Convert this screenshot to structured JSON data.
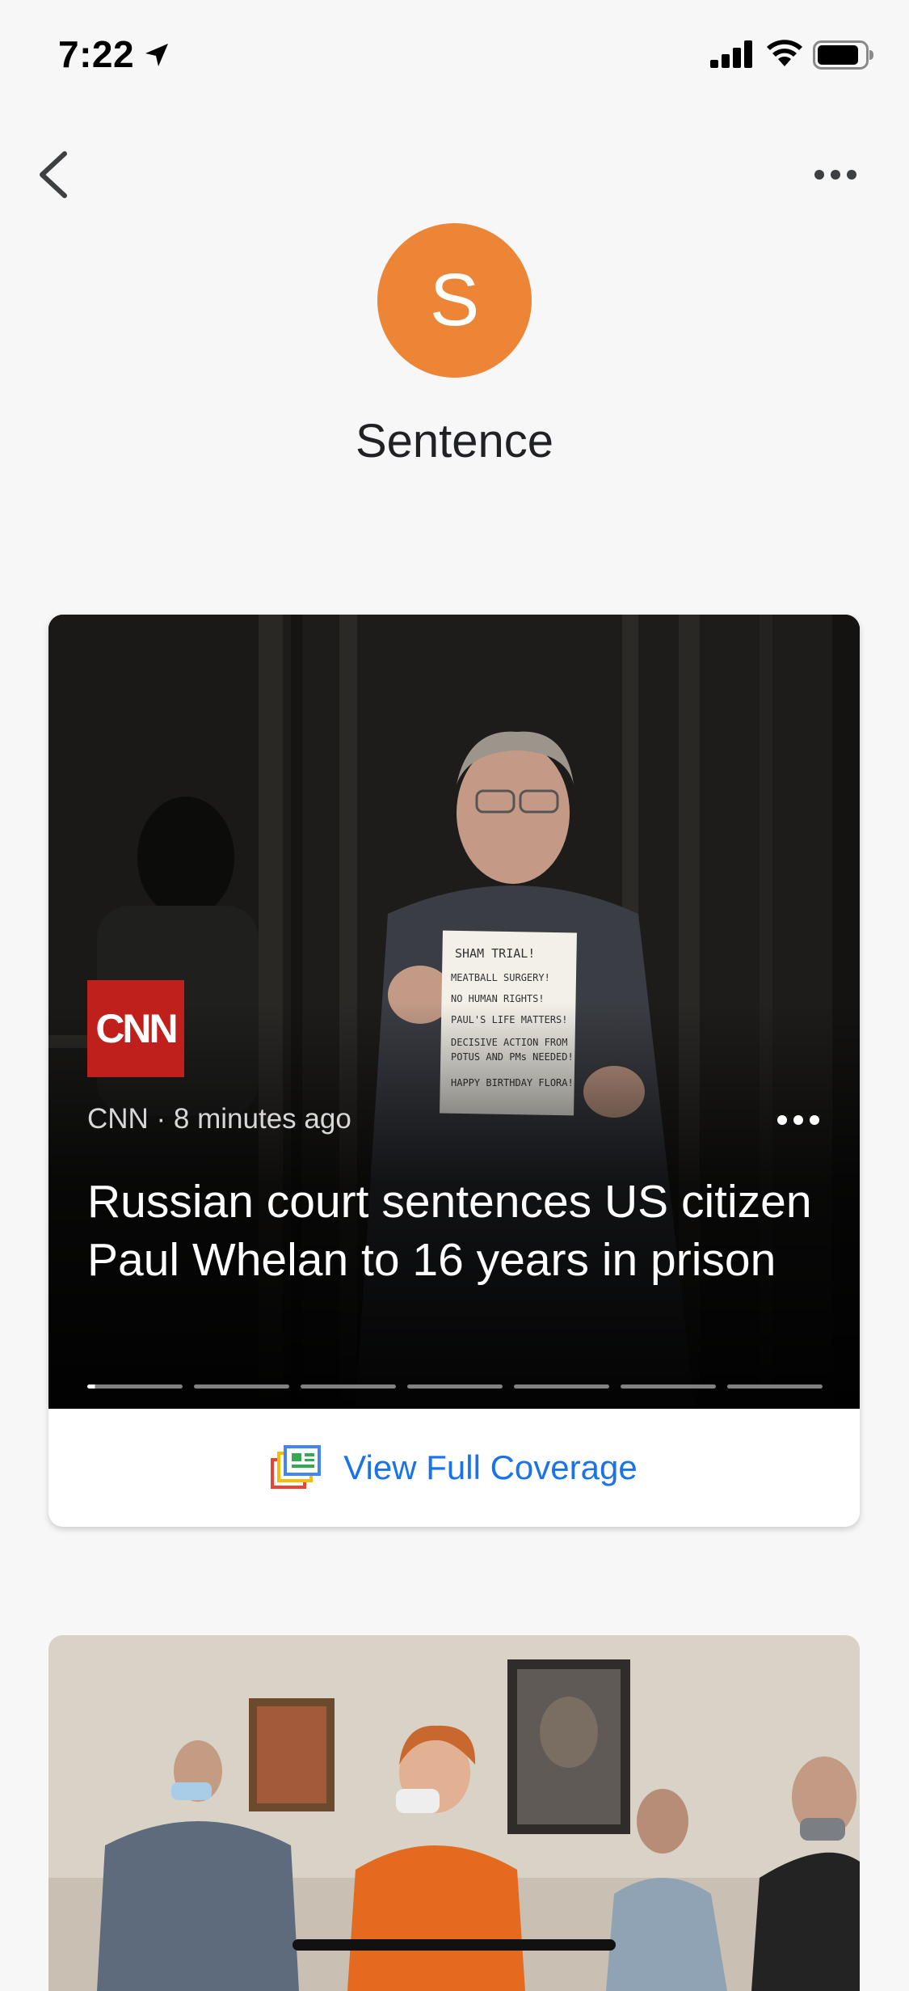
{
  "status_bar": {
    "time": "7:22"
  },
  "header": {
    "back_icon": "chevron-left-icon",
    "more_icon": "more-horizontal-icon"
  },
  "topic": {
    "avatar_letter": "S",
    "avatar_color": "#ec8536",
    "title": "Sentence"
  },
  "story": {
    "source_logo": "CNN",
    "source_logo_color": "#c0201c",
    "meta": "CNN · 8 minutes ago",
    "headline": "Russian court sentences US citizen Paul Whelan to 16 years in prison",
    "sign_lines": [
      "SHAM TRIAL!",
      "MEATBALL SURGERY!",
      "NO HUMAN RIGHTS!",
      "PAUL'S LIFE MATTERS!",
      "DECISIVE ACTION FROM",
      "POTUS AND PMs NEEDED!",
      "HAPPY BIRTHDAY FLORA!"
    ],
    "progress_segments": 7,
    "progress_active_index": 0,
    "view_full_coverage_label": "View Full Coverage",
    "accent_color": "#1a73e8"
  }
}
